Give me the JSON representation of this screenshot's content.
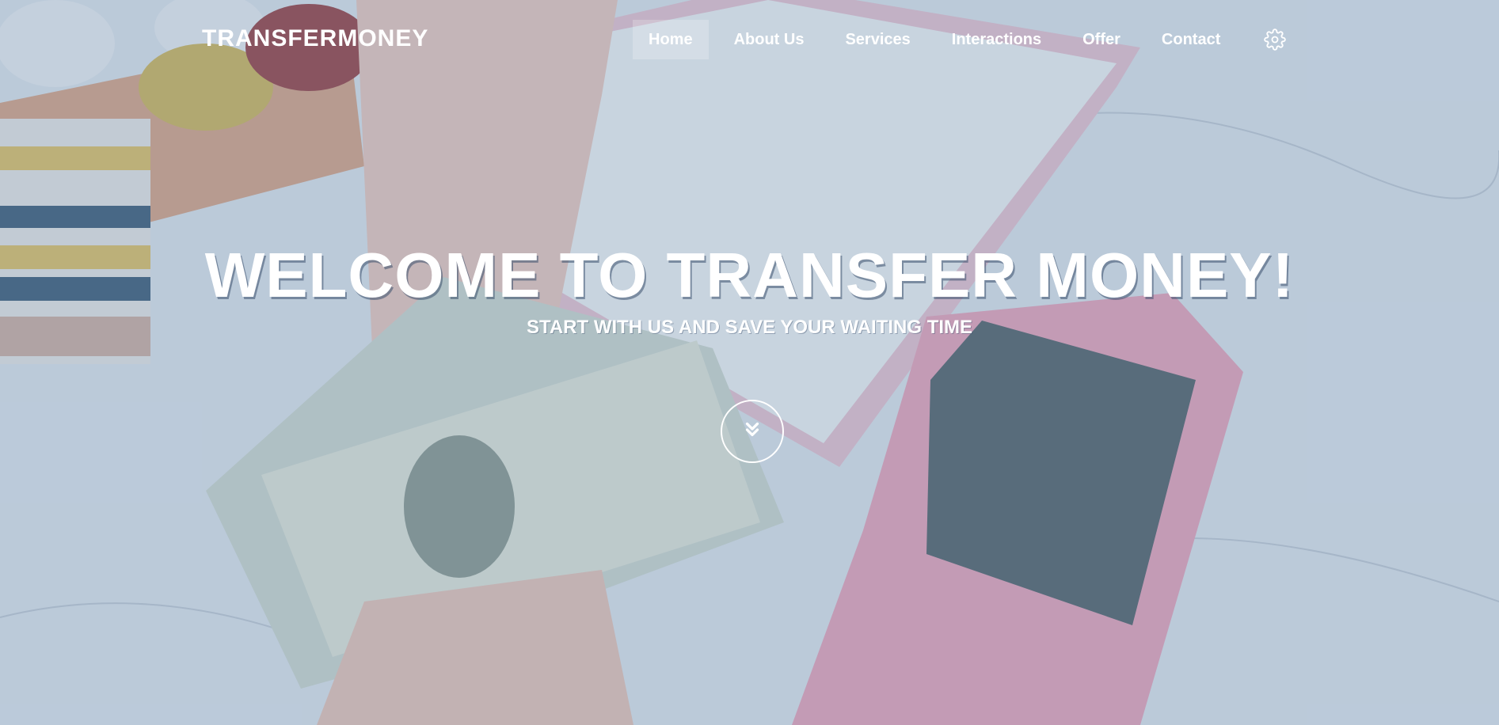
{
  "brand": {
    "name": "TRANSFERMONEY"
  },
  "nav": {
    "items": [
      {
        "label": "Home",
        "active": true
      },
      {
        "label": "About Us",
        "active": false
      },
      {
        "label": "Services",
        "active": false
      },
      {
        "label": "Interactions",
        "active": false
      },
      {
        "label": "Offer",
        "active": false
      },
      {
        "label": "Contact",
        "active": false
      }
    ],
    "settings_icon": "gear-icon"
  },
  "hero": {
    "title": "WELCOME TO TRANSFER MONEY!",
    "subtitle": "START WITH US AND SAVE YOUR WAITING TIME",
    "scroll_icon": "double-chevron-down-icon"
  },
  "colors": {
    "overlay": "#5f87af",
    "text": "#ffffff",
    "active_nav_bg": "#ffffff"
  }
}
